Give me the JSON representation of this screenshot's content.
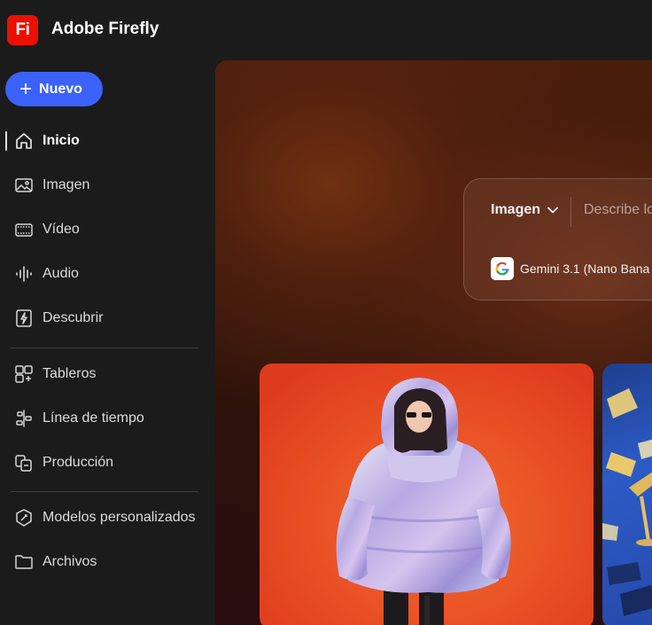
{
  "app": {
    "logo_text": "Fi",
    "title": "Adobe Firefly",
    "brand_color": "#eb1000"
  },
  "sidebar": {
    "new_button": "Nuevo",
    "accent_color": "#3b63fb",
    "items": [
      {
        "label": "Inicio",
        "icon": "home-icon",
        "active": true
      },
      {
        "label": "Imagen",
        "icon": "image-icon"
      },
      {
        "label": "Vídeo",
        "icon": "video-icon"
      },
      {
        "label": "Audio",
        "icon": "audio-waveform-icon"
      },
      {
        "label": "Descubrir",
        "icon": "discover-icon"
      },
      {
        "label": "Tableros",
        "icon": "boards-icon"
      },
      {
        "label": "Línea de tiempo",
        "icon": "timeline-icon"
      },
      {
        "label": "Producción",
        "icon": "production-icon"
      },
      {
        "label": "Modelos personalizados",
        "icon": "custom-models-icon"
      },
      {
        "label": "Archivos",
        "icon": "folder-icon"
      }
    ]
  },
  "prompt": {
    "type_label": "Imagen",
    "placeholder": "Describe lo",
    "model_label": "Gemini 3.1 (Nano Bana"
  }
}
